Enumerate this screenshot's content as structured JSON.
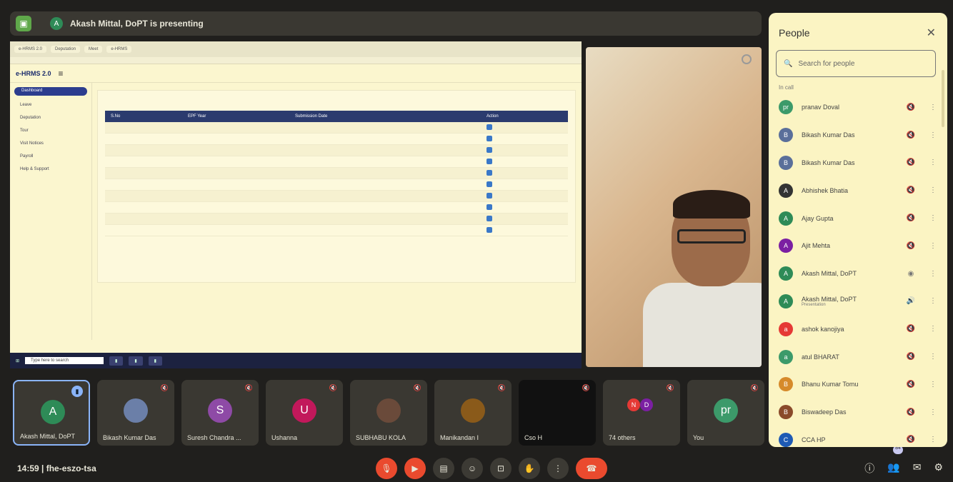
{
  "presenting": {
    "avatar": "A",
    "text": "Akash Mittal, DoPT is presenting"
  },
  "shared_screen": {
    "browser_tabs": [
      "e-HRMS 2.0",
      "Deputation",
      "Meet",
      "e-HRMS"
    ],
    "app_logo": "e-HRMS 2.0",
    "sidebar": [
      "Dashboard",
      "Leave",
      "Deputation",
      "Tour",
      "Visit Notices",
      "Payroll",
      "Help & Support"
    ],
    "table_headers": [
      "S.No",
      "EPF Year",
      "Submission Date",
      "Action"
    ],
    "row_count": 10,
    "taskbar_search": "Type here to search"
  },
  "participants": [
    {
      "name": "Akash Mittal, DoPT",
      "initial": "A",
      "color": "#2e8b57",
      "speaking": true
    },
    {
      "name": "Bikash Kumar Das",
      "initial": "",
      "color": "#6b7fa8",
      "speaking": false
    },
    {
      "name": "Suresh Chandra ...",
      "initial": "S",
      "color": "#8e4aa6",
      "speaking": false
    },
    {
      "name": "Ushanna",
      "initial": "U",
      "color": "#c2185b",
      "speaking": false
    },
    {
      "name": "SUBHABU KOLA",
      "initial": "",
      "color": "#6a4a3a",
      "speaking": false
    },
    {
      "name": "Manikandan I",
      "initial": "",
      "color": "#8a5a1a",
      "speaking": false
    },
    {
      "name": "Cso H",
      "initial": "",
      "color": "#111111",
      "speaking": false
    },
    {
      "name": "74 others",
      "initial": "",
      "color": "#3a3832",
      "speaking": false
    },
    {
      "name": "You",
      "initial": "pr",
      "color": "#3c9a6a",
      "speaking": false
    }
  ],
  "others_avatars": [
    "N",
    "D"
  ],
  "clock": "14:59",
  "meeting_code": "fhe-eszo-tsa",
  "participant_badge": "84",
  "people_panel": {
    "title": "People",
    "search_placeholder": "Search for people",
    "section": "In call",
    "list": [
      {
        "name": "pranav Doval",
        "initial": "pr",
        "color": "#3c9a6a",
        "mic": "muted"
      },
      {
        "name": "Bikash Kumar Das",
        "initial": "B",
        "color": "#5a6f9a",
        "mic": "muted"
      },
      {
        "name": "Bikash Kumar Das",
        "initial": "B",
        "color": "#5a6f9a",
        "mic": "muted"
      },
      {
        "name": "Abhishek Bhatia",
        "initial": "A",
        "color": "#333333",
        "mic": "muted"
      },
      {
        "name": "Ajay Gupta",
        "initial": "A",
        "color": "#2e8b57",
        "mic": "muted"
      },
      {
        "name": "Ajit Mehta",
        "initial": "A",
        "color": "#7b1fa2",
        "mic": "muted"
      },
      {
        "name": "Akash Mittal, DoPT",
        "initial": "A",
        "color": "#2e8b57",
        "mic": "speaking"
      },
      {
        "name": "Akash Mittal, DoPT",
        "sub": "Presentation",
        "initial": "A",
        "color": "#2e8b57",
        "mic": "on"
      },
      {
        "name": "ashok kanojiya",
        "initial": "a",
        "color": "#e53935",
        "mic": "muted"
      },
      {
        "name": "atul BHARAT",
        "initial": "a",
        "color": "#3c9a6a",
        "mic": "muted"
      },
      {
        "name": "Bhanu Kumar Tomu",
        "initial": "B",
        "color": "#d68a2a",
        "mic": "muted"
      },
      {
        "name": "Biswadeep Das",
        "initial": "B",
        "color": "#8a4a2a",
        "mic": "muted"
      },
      {
        "name": "CCA HP",
        "initial": "C",
        "color": "#1e5ab4",
        "mic": "muted"
      }
    ]
  }
}
